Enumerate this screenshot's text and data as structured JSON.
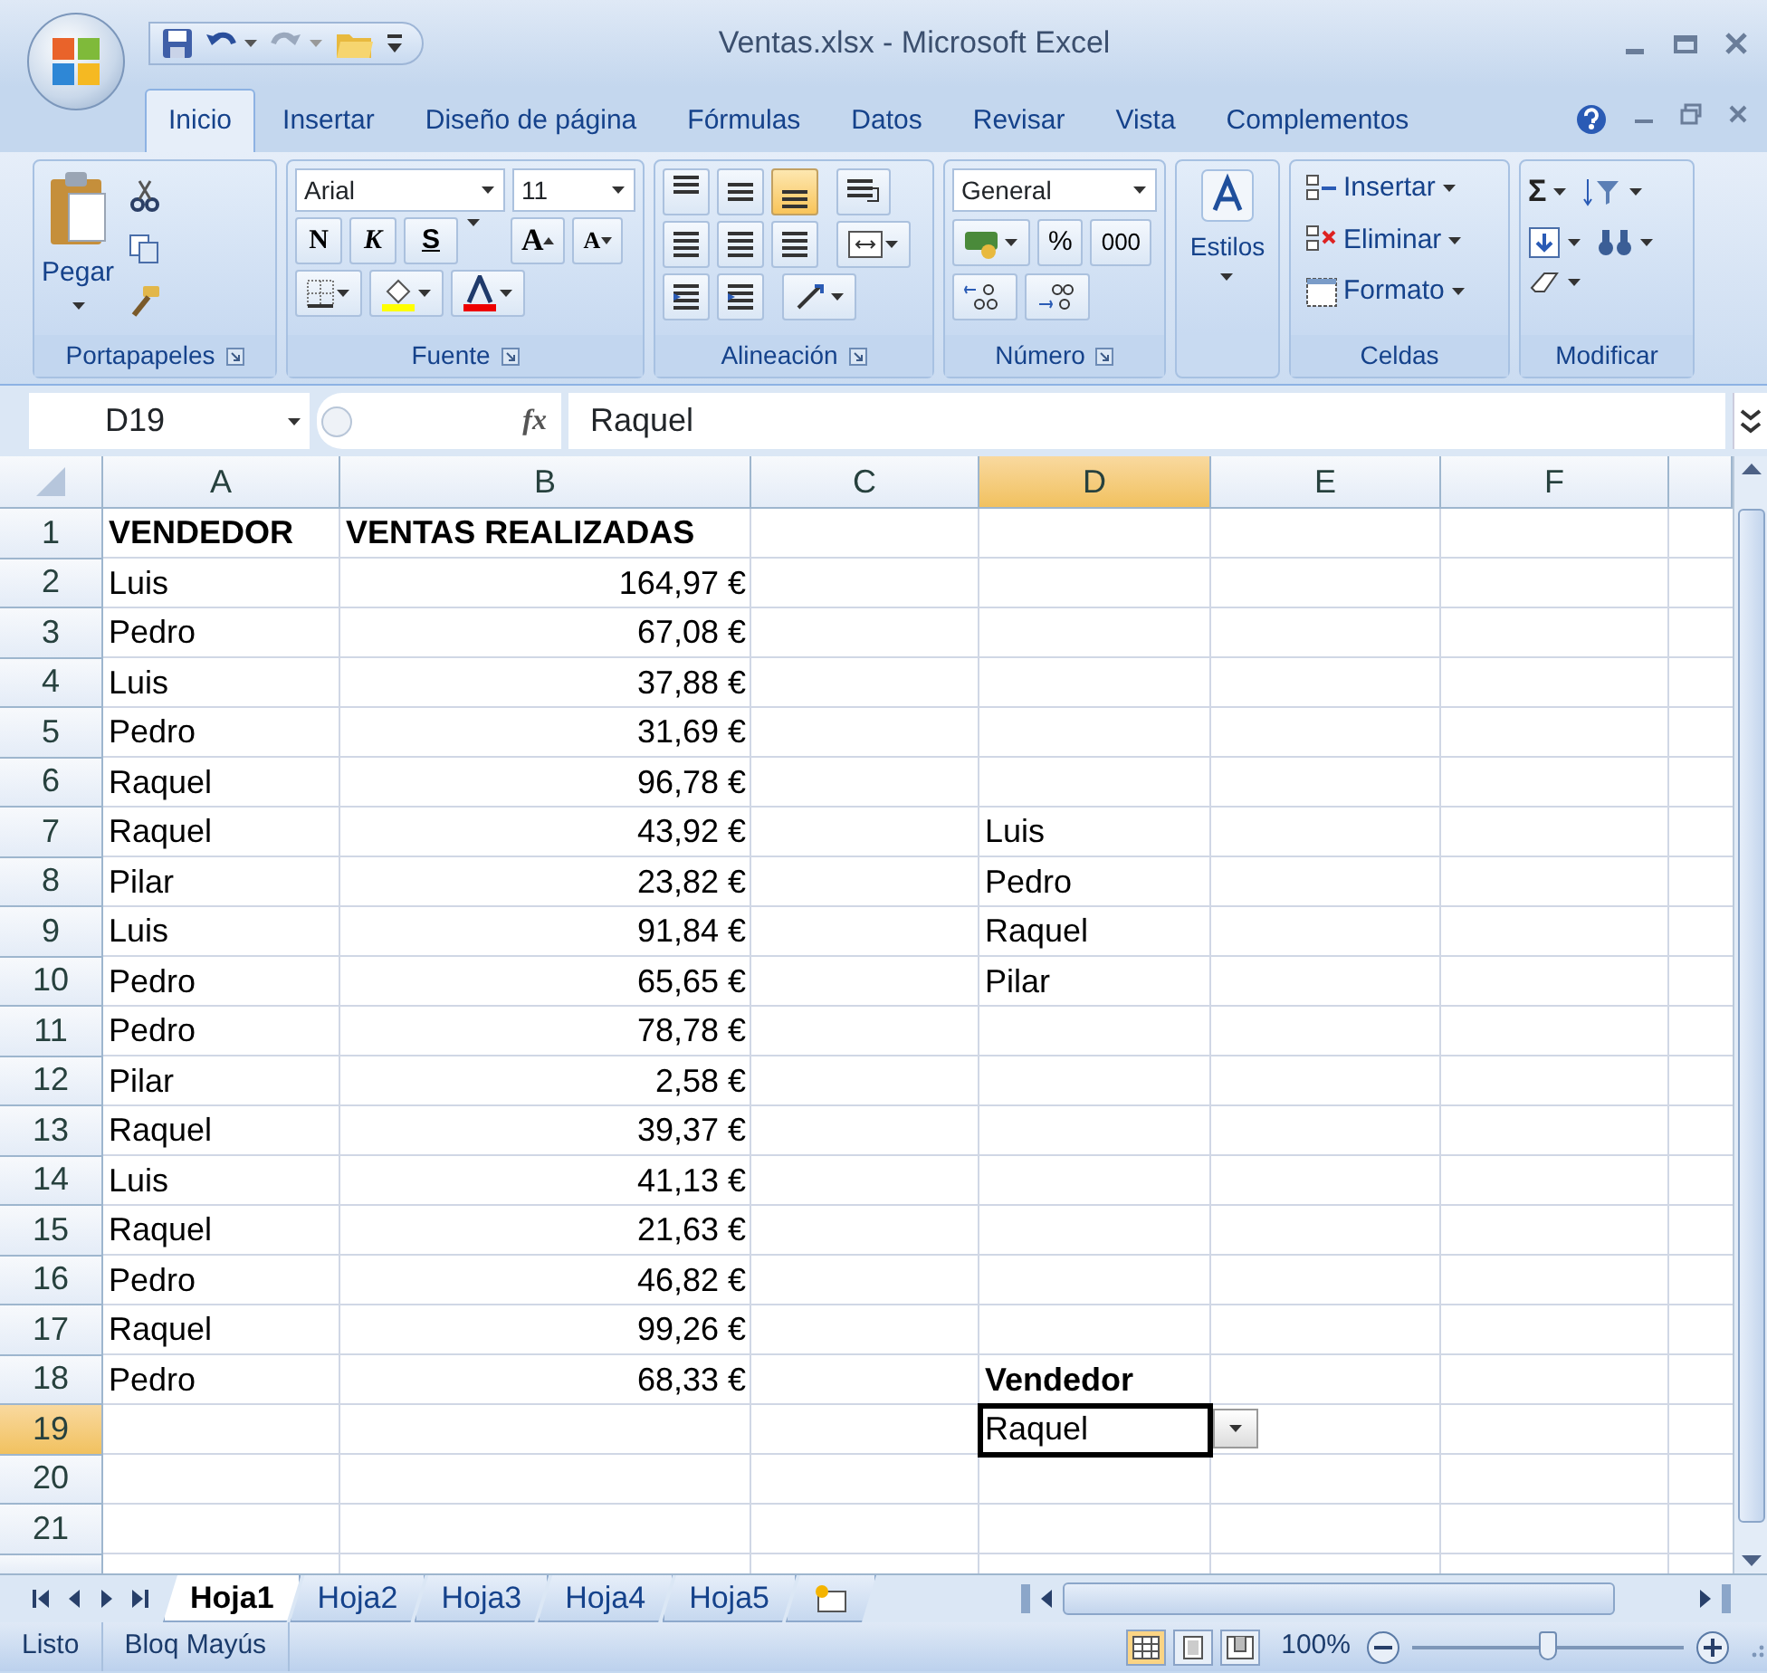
{
  "window": {
    "title": "Ventas.xlsx - Microsoft Excel"
  },
  "ribbon_tabs": [
    {
      "label": "Inicio",
      "selected": true
    },
    {
      "label": "Insertar",
      "selected": false
    },
    {
      "label": "Diseño de página",
      "selected": false
    },
    {
      "label": "Fórmulas",
      "selected": false
    },
    {
      "label": "Datos",
      "selected": false
    },
    {
      "label": "Revisar",
      "selected": false
    },
    {
      "label": "Vista",
      "selected": false
    },
    {
      "label": "Complementos",
      "selected": false
    }
  ],
  "ribbon": {
    "clipboard": {
      "label": "Portapapeles",
      "paste": "Pegar"
    },
    "font": {
      "label": "Fuente",
      "name": "Arial",
      "size": "11",
      "bold": "N",
      "italic": "K",
      "underline": "S",
      "grow": "A",
      "shrink": "A"
    },
    "alignment": {
      "label": "Alineación",
      "vertical_buttons": [
        {
          "selected": false
        },
        {
          "selected": false
        },
        {
          "selected": true
        }
      ]
    },
    "number": {
      "label": "Número",
      "format": "General",
      "percent": "%",
      "thousands": "000"
    },
    "styles": {
      "label": "Estilos"
    },
    "cells": {
      "label": "Celdas",
      "buttons": [
        "Insertar",
        "Eliminar",
        "Formato"
      ]
    },
    "editing": {
      "label": "Modificar",
      "sum": "Σ"
    }
  },
  "formula_bar": {
    "name_box": "D19",
    "function_symbol": "fx",
    "value": "Raquel"
  },
  "sheet": {
    "columns": [
      {
        "label": "A",
        "selected": false
      },
      {
        "label": "B",
        "selected": false
      },
      {
        "label": "C",
        "selected": false
      },
      {
        "label": "D",
        "selected": true
      },
      {
        "label": "E",
        "selected": false
      },
      {
        "label": "F",
        "selected": false
      }
    ],
    "rows": [
      {
        "label": "1",
        "selected": false,
        "cells": [
          {
            "text": "VENDEDOR",
            "kind": "text",
            "bold": true
          },
          {
            "text": "VENTAS REALIZADAS",
            "kind": "text",
            "bold": true
          }
        ]
      },
      {
        "label": "2",
        "selected": false,
        "cells": [
          {
            "text": "Luis",
            "kind": "text",
            "bold": false
          },
          {
            "text": "164,97 €",
            "kind": "number",
            "bold": false
          }
        ]
      },
      {
        "label": "3",
        "selected": false,
        "cells": [
          {
            "text": "Pedro",
            "kind": "text",
            "bold": false
          },
          {
            "text": "67,08 €",
            "kind": "number",
            "bold": false
          }
        ]
      },
      {
        "label": "4",
        "selected": false,
        "cells": [
          {
            "text": "Luis",
            "kind": "text",
            "bold": false
          },
          {
            "text": "37,88 €",
            "kind": "number",
            "bold": false
          }
        ]
      },
      {
        "label": "5",
        "selected": false,
        "cells": [
          {
            "text": "Pedro",
            "kind": "text",
            "bold": false
          },
          {
            "text": "31,69 €",
            "kind": "number",
            "bold": false
          }
        ]
      },
      {
        "label": "6",
        "selected": false,
        "cells": [
          {
            "text": "Raquel",
            "kind": "text",
            "bold": false
          },
          {
            "text": "96,78 €",
            "kind": "number",
            "bold": false
          }
        ]
      },
      {
        "label": "7",
        "selected": false,
        "cells": [
          {
            "text": "Raquel",
            "kind": "text",
            "bold": false
          },
          {
            "text": "43,92 €",
            "kind": "number",
            "bold": false
          },
          {
            "kind": "empty"
          },
          {
            "text": "Luis",
            "kind": "text",
            "bold": false
          }
        ]
      },
      {
        "label": "8",
        "selected": false,
        "cells": [
          {
            "text": "Pilar",
            "kind": "text",
            "bold": false
          },
          {
            "text": "23,82 €",
            "kind": "number",
            "bold": false
          },
          {
            "kind": "empty"
          },
          {
            "text": "Pedro",
            "kind": "text",
            "bold": false
          }
        ]
      },
      {
        "label": "9",
        "selected": false,
        "cells": [
          {
            "text": "Luis",
            "kind": "text",
            "bold": false
          },
          {
            "text": "91,84 €",
            "kind": "number",
            "bold": false
          },
          {
            "kind": "empty"
          },
          {
            "text": "Raquel",
            "kind": "text",
            "bold": false
          }
        ]
      },
      {
        "label": "10",
        "selected": false,
        "cells": [
          {
            "text": "Pedro",
            "kind": "text",
            "bold": false
          },
          {
            "text": "65,65 €",
            "kind": "number",
            "bold": false
          },
          {
            "kind": "empty"
          },
          {
            "text": "Pilar",
            "kind": "text",
            "bold": false
          }
        ]
      },
      {
        "label": "11",
        "selected": false,
        "cells": [
          {
            "text": "Pedro",
            "kind": "text",
            "bold": false
          },
          {
            "text": "78,78 €",
            "kind": "number",
            "bold": false
          }
        ]
      },
      {
        "label": "12",
        "selected": false,
        "cells": [
          {
            "text": "Pilar",
            "kind": "text",
            "bold": false
          },
          {
            "text": "2,58 €",
            "kind": "number",
            "bold": false
          }
        ]
      },
      {
        "label": "13",
        "selected": false,
        "cells": [
          {
            "text": "Raquel",
            "kind": "text",
            "bold": false
          },
          {
            "text": "39,37 €",
            "kind": "number",
            "bold": false
          }
        ]
      },
      {
        "label": "14",
        "selected": false,
        "cells": [
          {
            "text": "Luis",
            "kind": "text",
            "bold": false
          },
          {
            "text": "41,13 €",
            "kind": "number",
            "bold": false
          }
        ]
      },
      {
        "label": "15",
        "selected": false,
        "cells": [
          {
            "text": "Raquel",
            "kind": "text",
            "bold": false
          },
          {
            "text": "21,63 €",
            "kind": "number",
            "bold": false
          }
        ]
      },
      {
        "label": "16",
        "selected": false,
        "cells": [
          {
            "text": "Pedro",
            "kind": "text",
            "bold": false
          },
          {
            "text": "46,82 €",
            "kind": "number",
            "bold": false
          }
        ]
      },
      {
        "label": "17",
        "selected": false,
        "cells": [
          {
            "text": "Raquel",
            "kind": "text",
            "bold": false
          },
          {
            "text": "99,26 €",
            "kind": "number",
            "bold": false
          }
        ]
      },
      {
        "label": "18",
        "selected": false,
        "cells": [
          {
            "text": "Pedro",
            "kind": "text",
            "bold": false
          },
          {
            "text": "68,33 €",
            "kind": "number",
            "bold": false
          },
          {
            "kind": "empty"
          },
          {
            "text": "Vendedor",
            "kind": "text",
            "bold": true
          }
        ]
      },
      {
        "label": "19",
        "selected": true,
        "cells": [
          {
            "kind": "empty"
          },
          {
            "kind": "empty"
          },
          {
            "kind": "empty"
          },
          {
            "text": "Raquel",
            "kind": "dropdown",
            "bold": false
          }
        ]
      },
      {
        "label": "20",
        "selected": false,
        "cells": []
      },
      {
        "label": "21",
        "selected": false,
        "cells": []
      }
    ]
  },
  "sheet_tabs": [
    {
      "label": "Hoja1",
      "selected": true
    },
    {
      "label": "Hoja2",
      "selected": false
    },
    {
      "label": "Hoja3",
      "selected": false
    },
    {
      "label": "Hoja4",
      "selected": false
    },
    {
      "label": "Hoja5",
      "selected": false
    }
  ],
  "status_bar": {
    "items": [
      "Listo",
      "Bloq Mayús"
    ],
    "views": [
      {
        "selected": true
      },
      {
        "selected": false
      },
      {
        "selected": false
      }
    ],
    "zoom": "100%",
    "zoom_slider": {
      "level": 0.5
    }
  }
}
